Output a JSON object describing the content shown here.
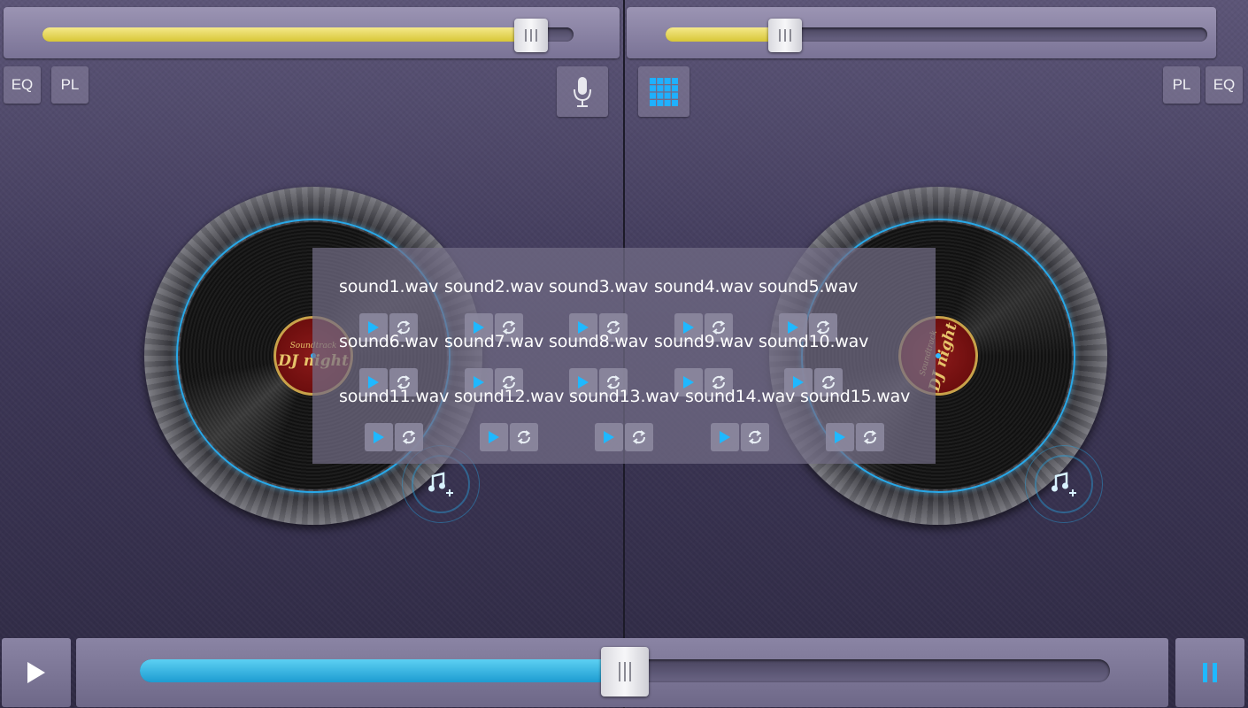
{
  "deck_left": {
    "pitch_level": 0.92,
    "eq_label": "EQ",
    "pl_label": "PL",
    "mic_icon": "microphone-icon",
    "record_label_top": "Soundtrack",
    "record_label_main": "DJ night",
    "add_music_icon": "add-music-icon"
  },
  "deck_right": {
    "pitch_level": 0.22,
    "eq_label": "EQ",
    "pl_label": "PL",
    "grid_icon": "sampler-grid-icon",
    "record_label_top": "Soundtrack",
    "record_label_main": "DJ night",
    "add_music_icon": "add-music-icon"
  },
  "sampler": {
    "sounds": [
      "sound1.wav",
      "sound2.wav",
      "sound3.wav",
      "sound4.wav",
      "sound5.wav",
      "sound6.wav",
      "sound7.wav",
      "sound8.wav",
      "sound9.wav",
      "sound10.wav",
      "sound11.wav",
      "sound12.wav",
      "sound13.wav",
      "sound14.wav",
      "sound15.wav"
    ]
  },
  "crossfader": {
    "level": 0.5
  },
  "controls": {
    "play_icon": "play-icon",
    "pause_icon": "pause-icon"
  },
  "colors": {
    "accent": "#1da0e0",
    "yellow": "#d8c737"
  }
}
